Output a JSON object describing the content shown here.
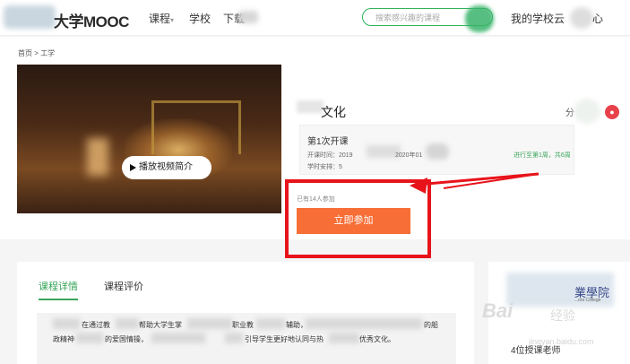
{
  "header": {
    "logo": "大学MOOC",
    "nav": [
      "课程",
      "学校",
      "下载"
    ],
    "search_placeholder": "搜索感兴趣的课程",
    "my_school": "我的学校云",
    "center_partial": "心"
  },
  "breadcrumb": "首页 > 工学",
  "video": {
    "play_label": "播放视频简介"
  },
  "course": {
    "title_partial": "文化",
    "share_partial": "分",
    "term_title": "第1次开课",
    "time_label": "开课时间：",
    "time_start_partial": "2019",
    "time_end_partial": "2020年01",
    "progress": "进行至第1周，共6周",
    "hours": "学时安排：",
    "hours_value": "5",
    "enroll_count": "已有14人参加",
    "join_button": "立即参加"
  },
  "tabs": [
    "课程详情",
    "课程评价"
  ],
  "description": {
    "line1_a": "在通过教",
    "line1_b": "帮助大学生掌",
    "line1_c": "职业教",
    "line1_d": "辅助，",
    "line1_e": "的船",
    "line2_a": "政精神",
    "line2_b": "的爱国情操，",
    "line2_c": "引导学生更好地认同与热",
    "line2_d": "优秀文化。"
  },
  "sidebar": {
    "school_chars": "業學院",
    "school_en": "...ors College",
    "teachers": "4位授课老师"
  },
  "watermark": {
    "brand": "Bai",
    "text": "经验",
    "url": "jingyan.baidu.com"
  },
  "colors": {
    "accent_green": "#3aa55a",
    "join_orange": "#f76e37",
    "highlight_red": "#e8131a"
  }
}
